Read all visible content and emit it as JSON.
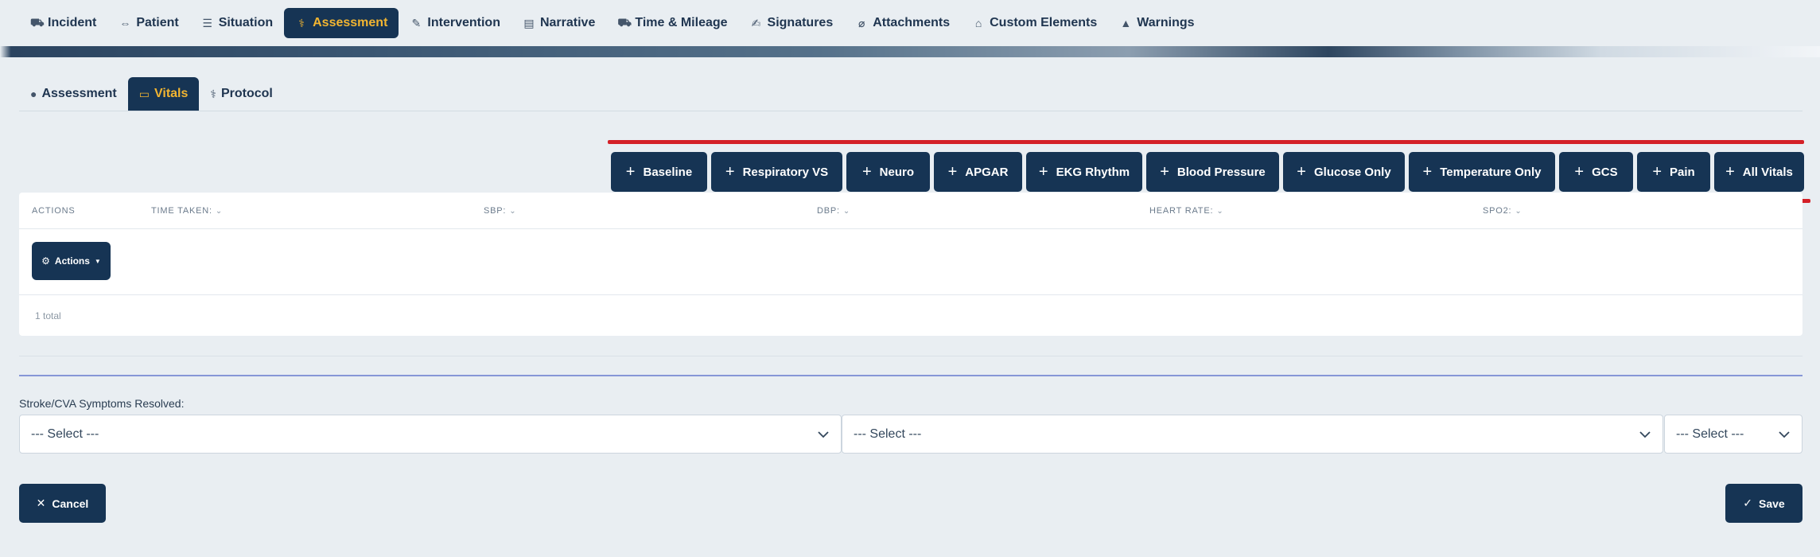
{
  "top_tabs": [
    {
      "label": "Incident",
      "icon": "ambulance-icon",
      "glyph": "⛟"
    },
    {
      "label": "Patient",
      "icon": "stretcher-icon",
      "glyph": "⇔"
    },
    {
      "label": "Situation",
      "icon": "situation-icon",
      "glyph": "☰"
    },
    {
      "label": "Assessment",
      "icon": "stethoscope-icon",
      "glyph": "⚕"
    },
    {
      "label": "Intervention",
      "icon": "syringe-icon",
      "glyph": "✎"
    },
    {
      "label": "Narrative",
      "icon": "notes-icon",
      "glyph": "▤"
    },
    {
      "label": "Time & Mileage",
      "icon": "car-clock-icon",
      "glyph": "⛟"
    },
    {
      "label": "Signatures",
      "icon": "signature-icon",
      "glyph": "✍"
    },
    {
      "label": "Attachments",
      "icon": "paperclip-icon",
      "glyph": "⌀"
    },
    {
      "label": "Custom Elements",
      "icon": "home-icon",
      "glyph": "⌂"
    },
    {
      "label": "Warnings",
      "icon": "warning-icon",
      "glyph": "▲"
    }
  ],
  "active_top_tab": "Assessment",
  "sub_tabs": [
    {
      "label": "Assessment",
      "icon": "assessment-icon",
      "glyph": "●"
    },
    {
      "label": "Vitals",
      "icon": "monitor-icon",
      "glyph": "▭"
    },
    {
      "label": "Protocol",
      "icon": "protocol-icon",
      "glyph": "⚕"
    }
  ],
  "active_sub_tab": "Vitals",
  "vitals_buttons": [
    {
      "label": "Baseline"
    },
    {
      "label": "Respiratory VS"
    },
    {
      "label": "Neuro"
    },
    {
      "label": "APGAR"
    },
    {
      "label": "EKG Rhythm"
    },
    {
      "label": "Blood Pressure"
    },
    {
      "label": "Glucose Only"
    },
    {
      "label": "Temperature Only"
    },
    {
      "label": "GCS"
    },
    {
      "label": "Pain"
    },
    {
      "label": "All Vitals"
    }
  ],
  "table": {
    "columns": [
      "ACTIONS",
      "TIME TAKEN:",
      "SBP:",
      "DBP:",
      "HEART RATE:",
      "SPO2:"
    ],
    "actions_label": "Actions",
    "total": "1 total"
  },
  "stroke": {
    "label": "Stroke/CVA Symptoms Resolved:",
    "selects": [
      "--- Select ---",
      "--- Select ---",
      "--- Select ---"
    ]
  },
  "footer": {
    "cancel_label": "Cancel",
    "save_label": "Save"
  },
  "colors": {
    "primary": "#163454",
    "active_text": "#f2b531",
    "annotation_red": "#d42027",
    "background": "#e9eef2"
  }
}
